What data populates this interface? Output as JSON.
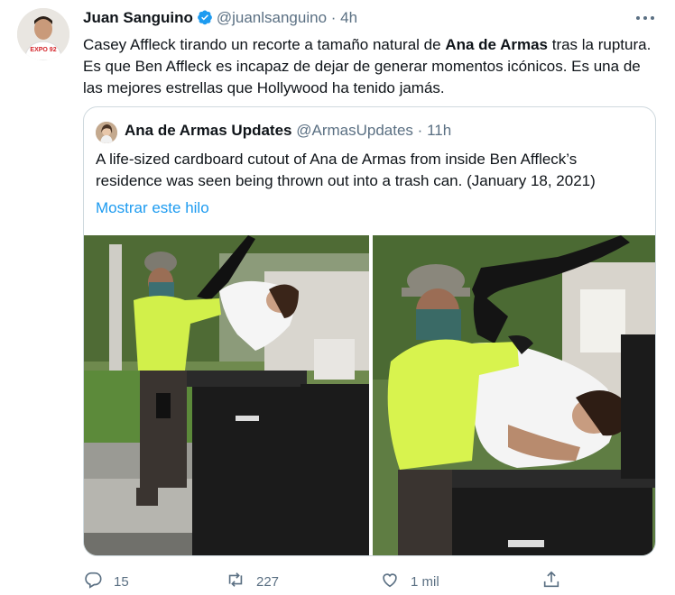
{
  "tweet": {
    "author_name": "Juan Sanguino",
    "author_handle": "@juanlsanguino",
    "time": "4h",
    "separator": "·",
    "text_part1": "Casey Affleck tirando un recorte a tamaño natural de ",
    "text_bold": "Ana de Armas",
    "text_part2": " tras la ruptura. Es que Ben Affleck es incapaz de dejar de generar momentos icónicos. Es una de las mejores estrellas que Hollywood ha tenido jamás."
  },
  "avatar_shirt_text": "EXPO 92",
  "quoted": {
    "author_name": "Ana de Armas Updates",
    "author_handle": "@ArmasUpdates",
    "separator": "·",
    "time": "11h",
    "text": "A life-sized cardboard cutout of Ana de Armas from inside Ben Affleck’s residence was seen being thrown out into a trash can. (January 18, 2021)",
    "show_thread": "Mostrar este hilo"
  },
  "actions": {
    "reply_count": "15",
    "retweet_count": "227",
    "like_count": "1 mil"
  },
  "colors": {
    "link": "#1d9bf0",
    "muted": "#5b7083",
    "border": "#cfd9de"
  },
  "icons": [
    "verified-badge-icon",
    "more-icon",
    "reply-icon",
    "retweet-icon",
    "like-icon",
    "share-icon"
  ]
}
